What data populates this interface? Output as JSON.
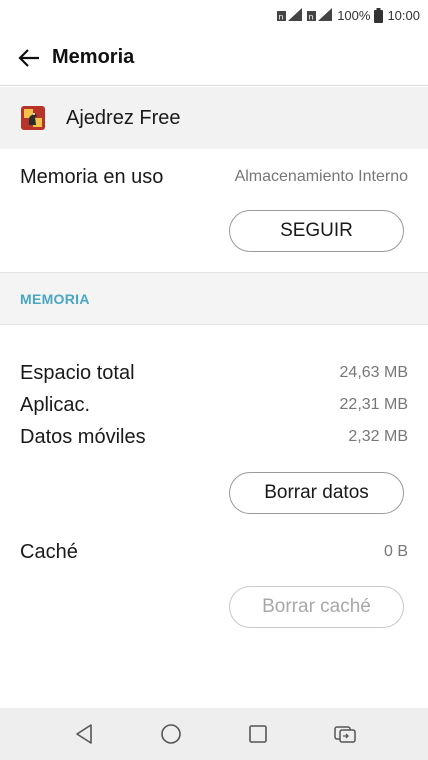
{
  "status_bar": {
    "battery": "100%",
    "time": "10:00"
  },
  "header": {
    "title": "Memoria"
  },
  "app": {
    "name": "Ajedrez Free"
  },
  "storage": {
    "label": "Memoria en uso",
    "value": "Almacenamiento Interno",
    "button_label": "SEGUIR"
  },
  "memory_section": {
    "title": "MEMORIA",
    "rows": [
      {
        "label": "Espacio total",
        "value": "24,63 MB"
      },
      {
        "label": "Aplicac.",
        "value": "22,31 MB"
      },
      {
        "label": "Datos móviles",
        "value": "2,32 MB"
      }
    ],
    "clear_data_label": "Borrar datos",
    "cache_label": "Caché",
    "cache_value": "0 B",
    "clear_cache_label": "Borrar caché"
  },
  "colors": {
    "accent": "#4aa6c4",
    "nav_bg": "#eeeeee",
    "header_bg": "#f2f2f2"
  },
  "icons": {
    "back": "arrow-left-icon",
    "app": "chess-app-icon",
    "nav": [
      "back-triangle-icon",
      "home-circle-icon",
      "recents-square-icon",
      "dual-window-icon"
    ]
  }
}
